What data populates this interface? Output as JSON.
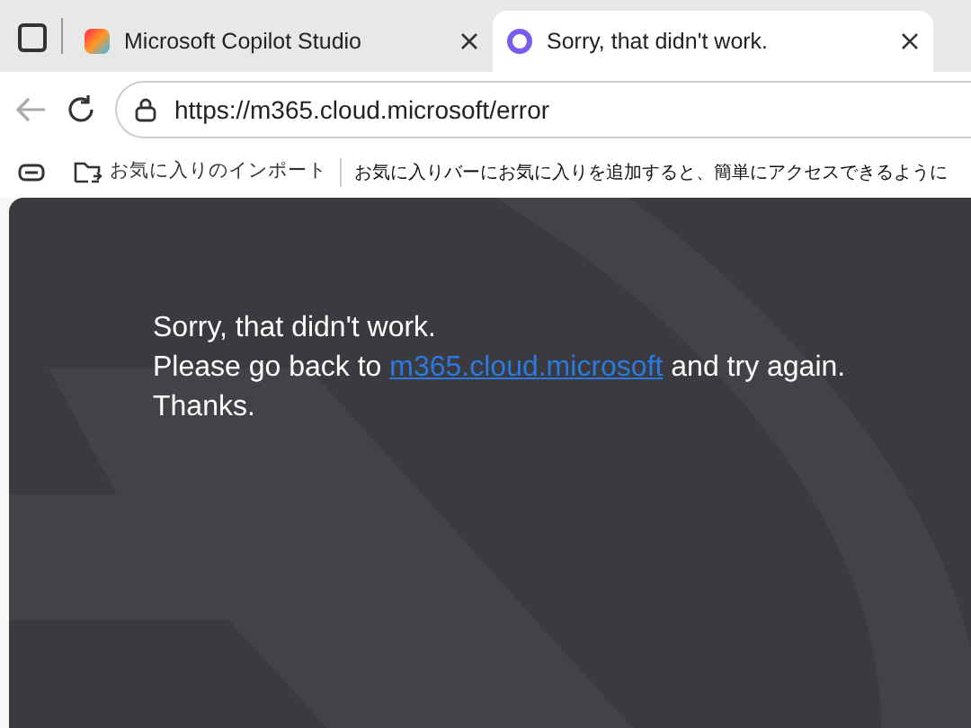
{
  "tabs": [
    {
      "title": "Microsoft Copilot Studio",
      "selected": false
    },
    {
      "title": "Sorry, that didn't work.",
      "selected": true
    }
  ],
  "address_bar": {
    "url": "https://m365.cloud.microsoft/error"
  },
  "favorites_bar": {
    "import_label": "お気に入りのインポート",
    "hint": "お気に入りバーにお気に入りを追加すると、簡単にアクセスできるように"
  },
  "message": {
    "lines": [
      {
        "parts": [
          {
            "kind": "text",
            "text": "Sorry, that didn't work."
          }
        ]
      },
      {
        "parts": [
          {
            "kind": "text",
            "text": "Please go back to "
          },
          {
            "kind": "link",
            "text": "m365.cloud.microsoft"
          },
          {
            "kind": "text",
            "text": " and try again."
          }
        ]
      },
      {
        "parts": [
          {
            "kind": "text",
            "text": "Thanks."
          }
        ]
      }
    ]
  }
}
